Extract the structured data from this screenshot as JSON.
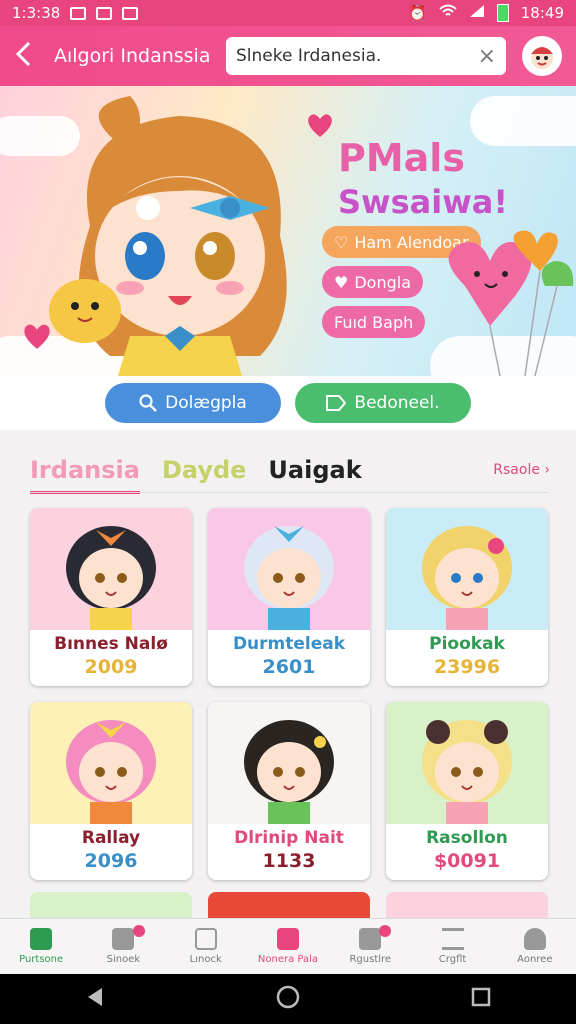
{
  "status": {
    "time_left": "1:3:38",
    "time_right": "18:49"
  },
  "appbar": {
    "back_label": "<",
    "title": "Aılgori Indanssia",
    "search_value": "Slneke Irdanesia.",
    "clear_label": "×"
  },
  "banner": {
    "title_line1": "PMals",
    "title_line2": "Swsaiwa!",
    "buttons": [
      {
        "label": "Ham Alendoar",
        "color": "#f5a55c"
      },
      {
        "label": "Dongla",
        "color": "#ee6aa7"
      },
      {
        "label": "Fuıd Baph",
        "color": "#ee6aa7"
      }
    ]
  },
  "actions": [
    {
      "label": "Dolægpla",
      "color": "#4a8fdc",
      "icon": "search-icon"
    },
    {
      "label": "Bedoneel.",
      "color": "#4bbd6e",
      "icon": "tag-icon"
    }
  ],
  "tabs": {
    "items": [
      {
        "label": "Irdansia",
        "color": "#f39ab6"
      },
      {
        "label": "Dayde",
        "color": "#c8d06a"
      },
      {
        "label": "Uaigak",
        "color": "#222222"
      }
    ],
    "more": "Rsaole ›"
  },
  "cards": [
    {
      "name": "Bınnes Nalø",
      "num": "2009",
      "name_color": "#8a1f2e",
      "num_color": "#e7b43a",
      "bg": "#fbd2de"
    },
    {
      "name": "Durmteleak",
      "num": "2601",
      "name_color": "#3a8fc8",
      "num_color": "#3a8fc8",
      "bg": "#f8c8e6"
    },
    {
      "name": "Piookak",
      "num": "23996",
      "name_color": "#2f9a52",
      "num_color": "#e7b43a",
      "bg": "#c9ecf7"
    },
    {
      "name": "Rallay",
      "num": "2096",
      "name_color": "#8a1f2e",
      "num_color": "#3a8fc8",
      "bg": "#fdf1b8"
    },
    {
      "name": "Dlrinip Nait",
      "num": "1133",
      "name_color": "#e04a7e",
      "num_color": "#8a1f2e",
      "bg": "#f7f4f4"
    },
    {
      "name": "Rasollon",
      "num": "$0091",
      "name_color": "#2f9a52",
      "num_color": "#e04a7e",
      "bg": "#d8f1c8"
    }
  ],
  "bottomnav": [
    {
      "label": "Purtsone",
      "color": "#2f9a52",
      "icon": "home-icon"
    },
    {
      "label": "Sinoek",
      "color": "#777777",
      "icon": "news-icon"
    },
    {
      "label": "Lınock",
      "color": "#777777",
      "icon": "puzzle-icon"
    },
    {
      "label": "Nonera Pala",
      "color": "#e8457f",
      "icon": "shop-icon"
    },
    {
      "label": "Rgustlre",
      "color": "#777777",
      "icon": "gift-icon"
    },
    {
      "label": "Crgflt",
      "color": "#777777",
      "icon": "menu-icon"
    },
    {
      "label": "Aonree",
      "color": "#777777",
      "icon": "profile-icon"
    }
  ]
}
